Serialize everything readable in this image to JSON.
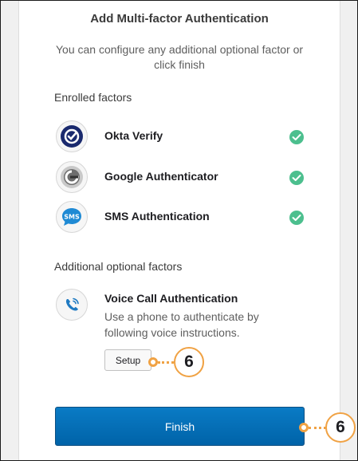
{
  "header": {
    "title": "Add Multi-factor Authentication",
    "subtitle": "You can configure any additional optional factor or click finish"
  },
  "enrolled": {
    "heading": "Enrolled factors",
    "factors": [
      {
        "name": "Okta Verify",
        "icon": "okta-verify-icon",
        "status": "enrolled-check-icon"
      },
      {
        "name": "Google Authenticator",
        "icon": "google-authenticator-icon",
        "status": "enrolled-check-icon"
      },
      {
        "name": "SMS Authentication",
        "icon": "sms-icon",
        "status": "enrolled-check-icon"
      }
    ]
  },
  "optional": {
    "heading": "Additional optional factors",
    "factors": [
      {
        "name": "Voice Call Authentication",
        "description": "Use a phone to authenticate by following voice instructions.",
        "icon": "voice-call-icon",
        "setup_label": "Setup"
      }
    ]
  },
  "actions": {
    "finish_label": "Finish"
  },
  "callouts": {
    "setup_step": "6",
    "finish_step": "6"
  },
  "colors": {
    "primary": "#0a74bb",
    "check": "#4cbf8e",
    "callout": "#f0a244",
    "sms_blue": "#1f8ad4"
  }
}
